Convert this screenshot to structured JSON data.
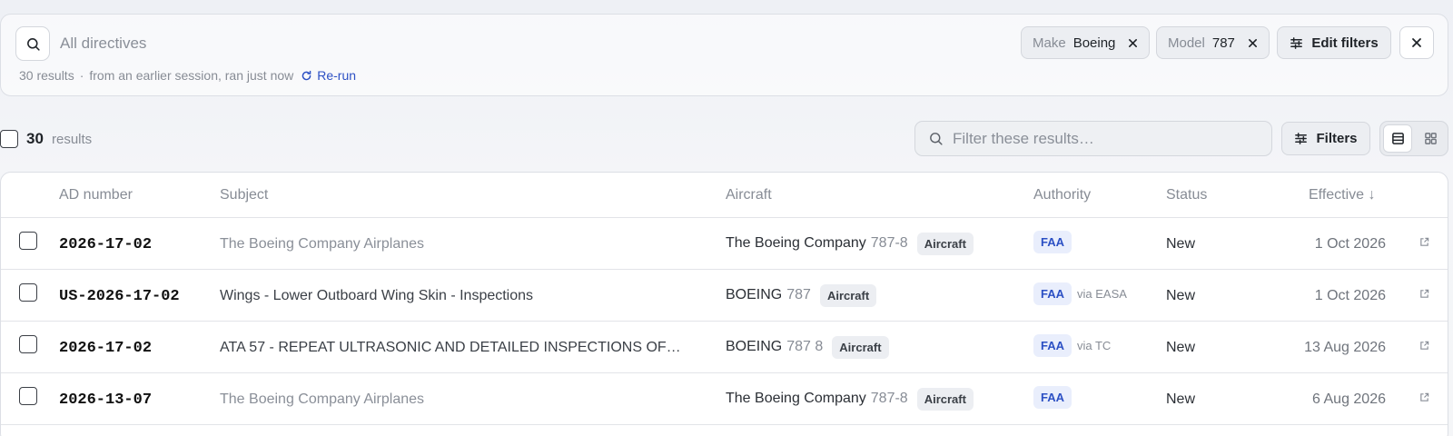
{
  "search": {
    "placeholder": "All directives",
    "chips": [
      {
        "key": "Make",
        "value": "Boeing"
      },
      {
        "key": "Model",
        "value": "787"
      }
    ],
    "edit_filters_label": "Edit filters",
    "meta": {
      "results": "30 results",
      "separator": "·",
      "session": "from an earlier session, ran just now",
      "rerun_label": "Re-run"
    }
  },
  "toolbar": {
    "count": "30",
    "count_label": "results",
    "filter_placeholder": "Filter these results…",
    "filters_label": "Filters"
  },
  "table": {
    "columns": {
      "ad": "AD number",
      "subject": "Subject",
      "aircraft": "Aircraft",
      "authority": "Authority",
      "status": "Status",
      "effective": "Effective ↓"
    },
    "rows": [
      {
        "ad": "2026-17-02",
        "subject": "The Boeing Company Airplanes",
        "maker": "The Boeing Company",
        "model": "787-8",
        "tag": "Aircraft",
        "authority": "FAA",
        "via": "",
        "status": "New",
        "effective": "1 Oct 2026"
      },
      {
        "ad": "US-2026-17-02",
        "subject": "Wings - Lower Outboard Wing Skin - Inspections",
        "maker": "BOEING",
        "model": "787",
        "tag": "Aircraft",
        "authority": "FAA",
        "via": "via EASA",
        "status": "New",
        "effective": "1 Oct 2026"
      },
      {
        "ad": "2026-17-02",
        "subject": "ATA 57 - REPEAT ULTRASONIC AND DETAILED INSPECTIONS OF…",
        "maker": "BOEING",
        "model": "787 8",
        "tag": "Aircraft",
        "authority": "FAA",
        "via": "via TC",
        "status": "New",
        "effective": "13 Aug 2026"
      },
      {
        "ad": "2026-13-07",
        "subject": "The Boeing Company Airplanes",
        "maker": "The Boeing Company",
        "model": "787-8",
        "tag": "Aircraft",
        "authority": "FAA",
        "via": "",
        "status": "New",
        "effective": "6 Aug 2026"
      }
    ]
  }
}
